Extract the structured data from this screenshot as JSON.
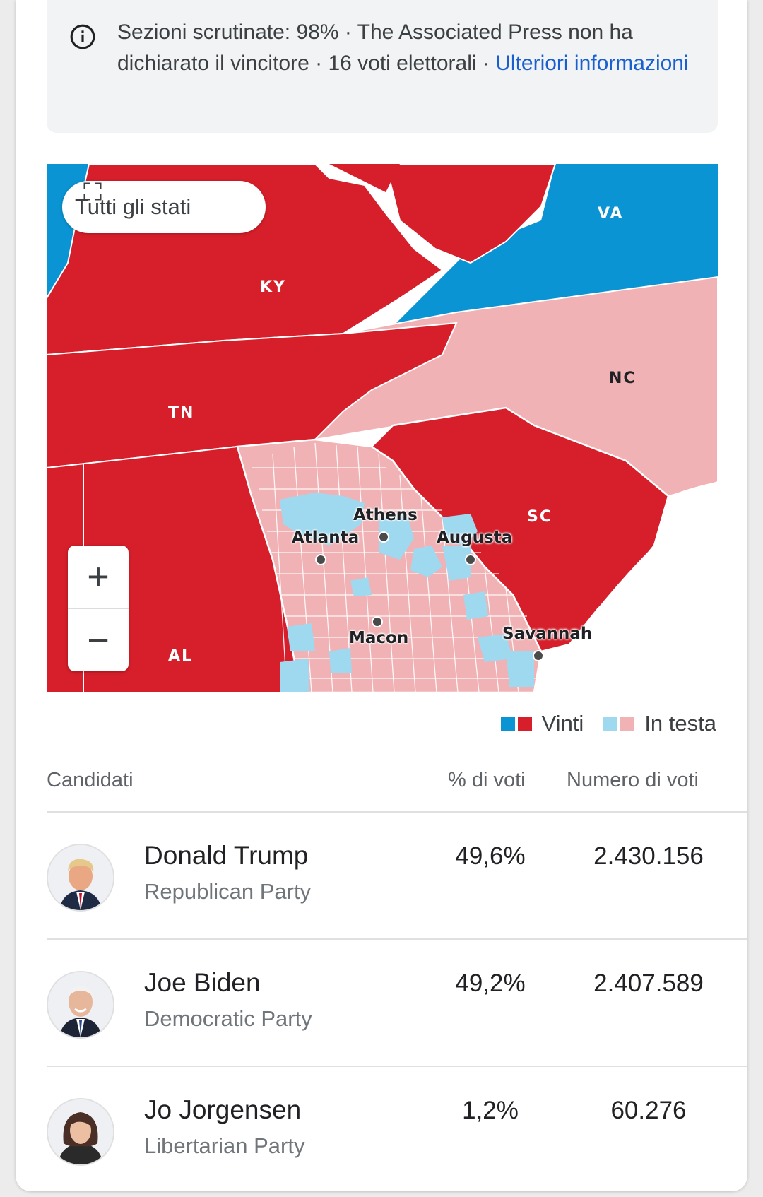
{
  "info": {
    "text": "Sezioni scrutinate: 98% · The Associated Press non ha dichiarato il vincitore · 16 voti elettorali · ",
    "link": "Ulteriori informazioni",
    "icon": "info-icon"
  },
  "map": {
    "all_states_label": "Tutti gli stati",
    "zoom_in": "+",
    "zoom_out": "−",
    "states": [
      "VA",
      "KY",
      "NC",
      "TN",
      "SC",
      "AL"
    ],
    "cities": [
      "Athens",
      "Atlanta",
      "Augusta",
      "Macon",
      "Savannah"
    ],
    "colors": {
      "won_red": "#d61f2b",
      "won_blue": "#0b94d3",
      "leading_red": "#f0b2b5",
      "leading_blue": "#9fd9ef"
    }
  },
  "legend": {
    "won": "Vinti",
    "leading": "In testa"
  },
  "table": {
    "headers": {
      "candidates": "Candidati",
      "percent": "% di voti",
      "votes": "Numero di voti"
    },
    "rows": [
      {
        "name": "Donald Trump",
        "party": "Republican Party",
        "percent": "49,6%",
        "votes": "2.430.156"
      },
      {
        "name": "Joe Biden",
        "party": "Democratic Party",
        "percent": "49,2%",
        "votes": "2.407.589"
      },
      {
        "name": "Jo Jorgensen",
        "party": "Libertarian Party",
        "percent": "1,2%",
        "votes": "60.276"
      }
    ]
  }
}
